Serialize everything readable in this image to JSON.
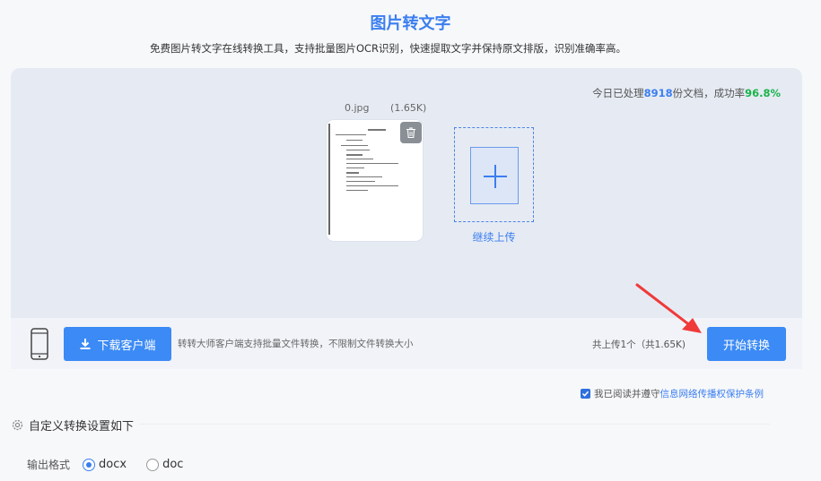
{
  "header": {
    "title": "图片转文字",
    "subtitle": "免费图片转文字在线转换工具，支持批量图片OCR识别，快速提取文字并保持原文排版，识别准确率高。"
  },
  "stats": {
    "prefix": "今日已处理",
    "count": "8918",
    "middle": "份文档，成功率",
    "rate": "96.8%"
  },
  "file": {
    "name": "0.jpg",
    "size": "(1.65K)"
  },
  "upload": {
    "continue_label": "继续上传"
  },
  "bottom_bar": {
    "download_label": "下载客户端",
    "client_tip": "转转大师客户端支持批量文件转换，不限制文件转换大小",
    "upload_count": "共上传1个（共1.65K)",
    "start_label": "开始转换"
  },
  "agreement": {
    "text": "我已阅读并遵守",
    "link": "信息网络传播权保护条例",
    "checked": true
  },
  "settings": {
    "title": "自定义转换设置如下",
    "output_label": "输出格式",
    "options": [
      "docx",
      "doc"
    ],
    "selected": "docx"
  },
  "colors": {
    "accent": "#3b7ef0",
    "success": "#1ab34a",
    "arrow": "#f03a3a"
  }
}
